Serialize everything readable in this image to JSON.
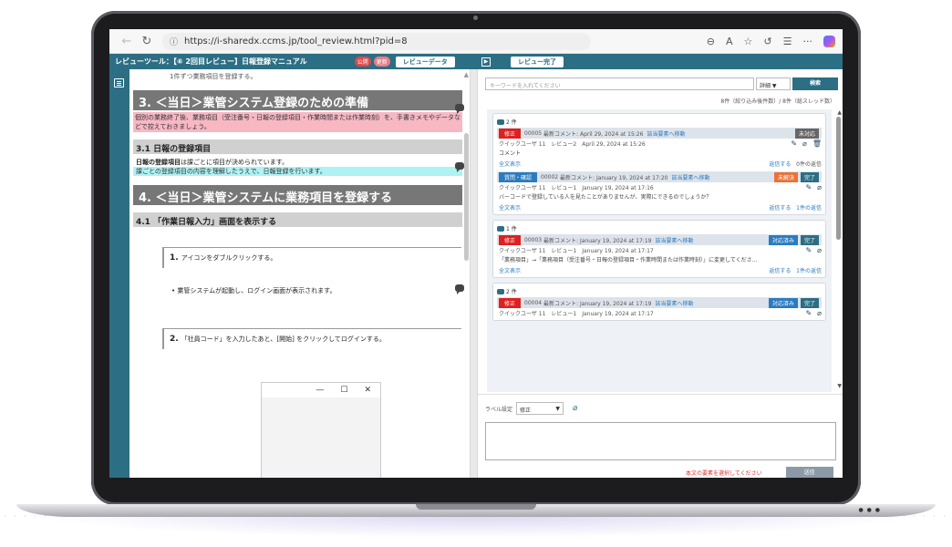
{
  "browser": {
    "url": "https://i-sharedx.ccms.jp/tool_review.html?pid=8"
  },
  "app": {
    "title": "レビューツール：【⑥ 2回目レビュー】日報登録マニュアル",
    "badge1": "公開",
    "badge2": "更新",
    "review_data_button": "レビューデータ",
    "review_done_button": "レビュー完了"
  },
  "doc": {
    "cut_line": "1件ずつ業務項目を登録する。",
    "h2_1": "3. ＜当日＞業管システム登録のための準備",
    "pink_text": "個別の業務終了後、業務項目（受注番号・日報の登録項目・作業時間または作業時刻）を、手書きメモやデータなどで控えておきましょう。",
    "h3_1": "3.1 日報の登録項目",
    "txt_bold": "日報の登録項目",
    "txt_rest": "は課ごとに項目が決められています。",
    "cyan_text": "課ごとの登録項目の内容を理解したうえで、日報登録を行います。",
    "h2_2": "4. ＜当日＞業管システムに業務項目を登録する",
    "h3_2": "4.1 「作業日報入力」画面を表示する",
    "step1_num": "1.",
    "step1_text": "アイコンをダブルクリックする。",
    "bullet1": "業管システムが起動し、ログイン画面が表示されます。",
    "step2_num": "2.",
    "step2_text": "「社員コード」を入力したあと、[開始] をクリックしてログインする。",
    "win_min": "—",
    "win_max": "☐",
    "win_close": "✕"
  },
  "panel": {
    "search_placeholder": "キーワードを入れてください",
    "detail_label": "詳細 ▼",
    "search_button": "検索",
    "count_text": "8件（絞り込み後件数）/ 8件（総スレッド数）",
    "threads": [
      {
        "count": "2 件",
        "label": "修正",
        "id": "00005",
        "latest": "最新コメント: April 29, 2024 at 15:26",
        "link": "該当要素へ移動",
        "status1": "未対応",
        "status2": "",
        "user": "クイックユーザ 11　レビュー2　April 29, 2024 at 15:26",
        "body": "コメント",
        "full": "全文表示",
        "reply": "返信する",
        "reply_count": "0件の返信"
      },
      {
        "count": "",
        "label": "質問・確認",
        "id": "00002",
        "latest": "最新コメント: January 19, 2024 at 17:20",
        "link": "該当要素へ移動",
        "status1": "未解決",
        "status2": "完了",
        "user": "クイックユーザ 11　レビュー1　January 19, 2024 at 17:16",
        "body": "バーコードで登録している人を見たことがありませんが、実際にできるのでしょうか？",
        "full": "全文表示",
        "reply": "返信する",
        "reply_count": "1件の返信"
      },
      {
        "count": "1 件",
        "label": "修正",
        "id": "00003",
        "latest": "最新コメント: January 19, 2024 at 17:19",
        "link": "該当要素へ移動",
        "status1": "対応済み",
        "status2": "完了",
        "user": "クイックユーザ 11　レビュー1　January 19, 2024 at 17:17",
        "body": "「業務項目」→「業務項目（受注番号・日報の登録項目・作業時間または作業時刻）」に変更してくださ…",
        "full": "全文表示",
        "reply": "返信する",
        "reply_count": "1件の返信"
      },
      {
        "count": "2 件",
        "label": "修正",
        "id": "00004",
        "latest": "最新コメント: January 19, 2024 at 17:19",
        "link": "該当要素へ移動",
        "status1": "対応済み",
        "status2": "完了",
        "user": "クイックユーザ 11　レビュー1　January 19, 2024 at 17:17",
        "body": "",
        "full": "",
        "reply": "",
        "reply_count": ""
      }
    ],
    "compose_label": "ラベル設定",
    "compose_select": "修正",
    "warn_text": "本文の要素を選択してください",
    "send_button": "送信"
  },
  "colors": {
    "brand": "#2c6e84",
    "danger": "#e02020",
    "link": "#2b7bc0"
  }
}
